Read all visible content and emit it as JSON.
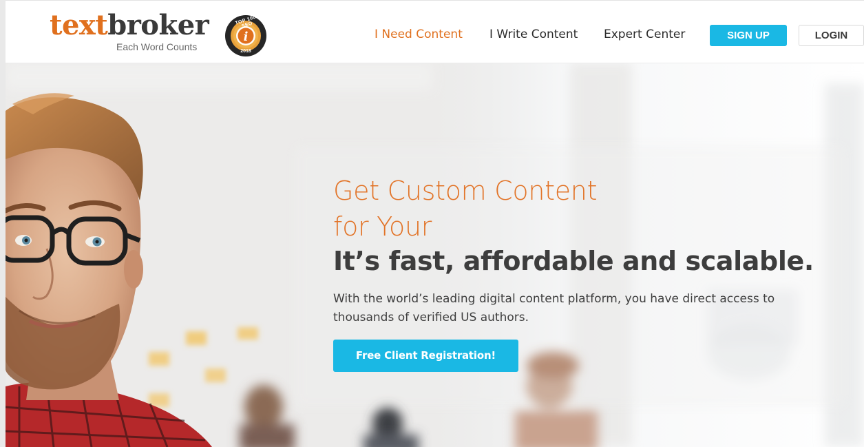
{
  "brand": {
    "logo_part1": "text",
    "logo_part2": "broker",
    "tagline": "Each Word Counts",
    "badge_top": "TOP 100 SEO",
    "badge_year": "2018",
    "accent_color": "#e0701e",
    "button_color": "#1ab8e4"
  },
  "nav": {
    "items": [
      {
        "label": "I Need Content",
        "active": true
      },
      {
        "label": "I Write Content",
        "active": false
      },
      {
        "label": "Expert Center",
        "active": false
      }
    ],
    "signup_label": "SIGN UP",
    "login_label": "LOGIN"
  },
  "hero": {
    "title_line1": "Get Custom Content",
    "title_line2": "for Your",
    "subtitle": "It’s fast, affordable and scalable.",
    "text": "With the world’s leading digital content platform, you have direct access to thousands of verified US authors.",
    "cta_label": "Free Client Registration!"
  }
}
